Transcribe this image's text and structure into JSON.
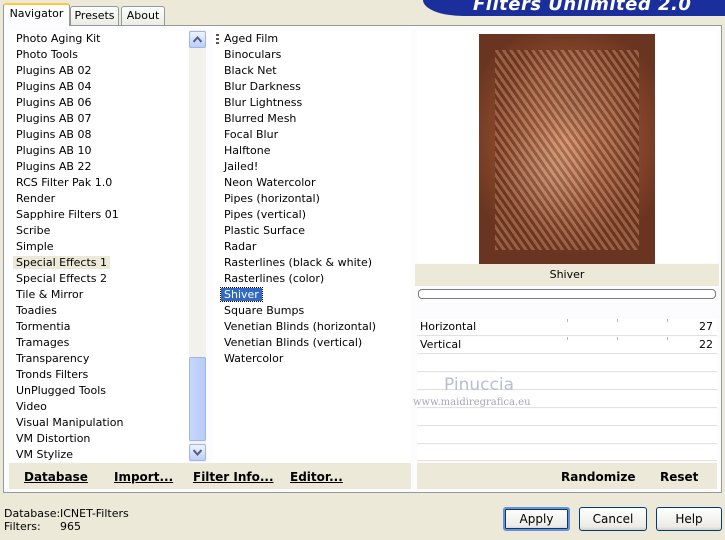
{
  "tabs": [
    "Navigator",
    "Presets",
    "About"
  ],
  "app_title": "Filters Unlimited 2.0",
  "categories": [
    "Photo Aging Kit",
    "Photo Tools",
    "Plugins AB 02",
    "Plugins AB 04",
    "Plugins AB 06",
    "Plugins AB 07",
    "Plugins AB 08",
    "Plugins AB 10",
    "Plugins AB 22",
    "RCS Filter Pak 1.0",
    "Render",
    "Sapphire Filters 01",
    "Scribe",
    "Simple",
    "Special Effects 1",
    "Special Effects 2",
    "Tile & Mirror",
    "Toadies",
    "Tormentia",
    "Tramages",
    "Transparency",
    "Tronds Filters",
    "UnPlugged Tools",
    "Video",
    "Visual Manipulation",
    "VM Distortion",
    "VM Stylize"
  ],
  "selected_category": "Special Effects 1",
  "filters": [
    "Aged Film",
    "Binoculars",
    "Black Net",
    "Blur Darkness",
    "Blur Lightness",
    "Blurred Mesh",
    "Focal Blur",
    "Halftone",
    "Jailed!",
    "Neon Watercolor",
    "Pipes (horizontal)",
    "Pipes (vertical)",
    "Plastic Surface",
    "Radar",
    "Rasterlines (black & white)",
    "Rasterlines (color)",
    "Shiver",
    "Square Bumps",
    "Venetian Blinds (horizontal)",
    "Venetian Blinds (vertical)",
    "Watercolor"
  ],
  "selected_filter": "Shiver",
  "filter_name": "Shiver",
  "params": [
    {
      "label": "Horizontal",
      "value": "27"
    },
    {
      "label": "Vertical",
      "value": "22"
    }
  ],
  "watermark": {
    "name": "Pinuccia",
    "url": "www.maidiregrafica.eu"
  },
  "links": {
    "database": "Database",
    "import": "Import...",
    "filter_info": "Filter Info...",
    "editor": "Editor...",
    "randomize": "Randomize",
    "reset": "Reset"
  },
  "status": {
    "database_label": "Database:",
    "database_value": "ICNET-Filters",
    "filters_label": "Filters:",
    "filters_value": "965"
  },
  "buttons": {
    "apply": "Apply",
    "cancel": "Cancel",
    "help": "Help"
  },
  "colors": {
    "selection": "#316ac5",
    "banner": "#1a2f9c",
    "face": "#ece9d8"
  }
}
